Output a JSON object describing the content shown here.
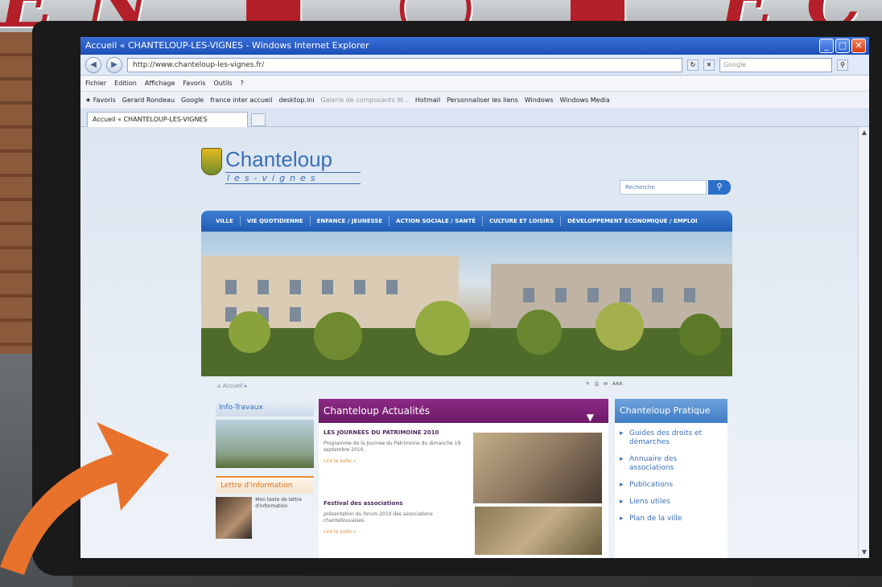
{
  "browser": {
    "title": "Accueil « CHANTELOUP-LES-VIGNES - Windows Internet Explorer",
    "url": "http://www.chanteloup-les-vignes.fr/",
    "search_placeholder": "Google",
    "menu": [
      "Fichier",
      "Edition",
      "Affichage",
      "Favoris",
      "Outils",
      "?"
    ],
    "favorites": {
      "label": "Favoris",
      "items": [
        "Gerard Rondeau",
        "Google",
        "france inter accueil",
        "desktop.ini",
        "Galerie de composants W...",
        "Hotmail",
        "Personnaliser les liens",
        "Windows",
        "Windows Media"
      ]
    },
    "tab_label": "Accueil « CHANTELOUP-LES-VIGNES"
  },
  "site": {
    "logo_title": "Chanteloup",
    "logo_sub": "les-vignes",
    "search_placeholder": "Recherche",
    "nav": [
      "VILLE",
      "VIE QUOTIDIENNE",
      "ENFANCE / JEUNESSE",
      "ACTION SOCIALE / SANTÉ",
      "CULTURE ET LOISIRS",
      "DÉVELOPPEMENT ÉCONOMIQUE / EMPLOI"
    ],
    "breadcrumb": "Accueil ▸",
    "info_travaux": "Info-Travaux",
    "lettre": {
      "title": "Lettre d'information",
      "text": "Mon texte de lettre d'information"
    },
    "news": {
      "title": "Chanteloup Actualités",
      "items": [
        {
          "title": "LES JOURNEES DU PATRIMOINE 2010",
          "desc": "Programme de la Journée du Patrimoine du dimanche 19 septembre 2010.",
          "more": "Lire la suite »"
        },
        {
          "title": "Festival des associations",
          "desc": "présentation du forum 2010 des associations chantellouvaises.",
          "more": "Lire la suite »"
        }
      ]
    },
    "pratique": {
      "title": "Chanteloup Pratique",
      "links": [
        "Guides des droits et démarches",
        "Annuaire des associations",
        "Publications",
        "Liens utiles",
        "Plan de la ville"
      ]
    }
  },
  "colors": {
    "nav_blue": "#1f5db4",
    "news_purple": "#6b1a66",
    "accent_orange": "#e98b33"
  }
}
